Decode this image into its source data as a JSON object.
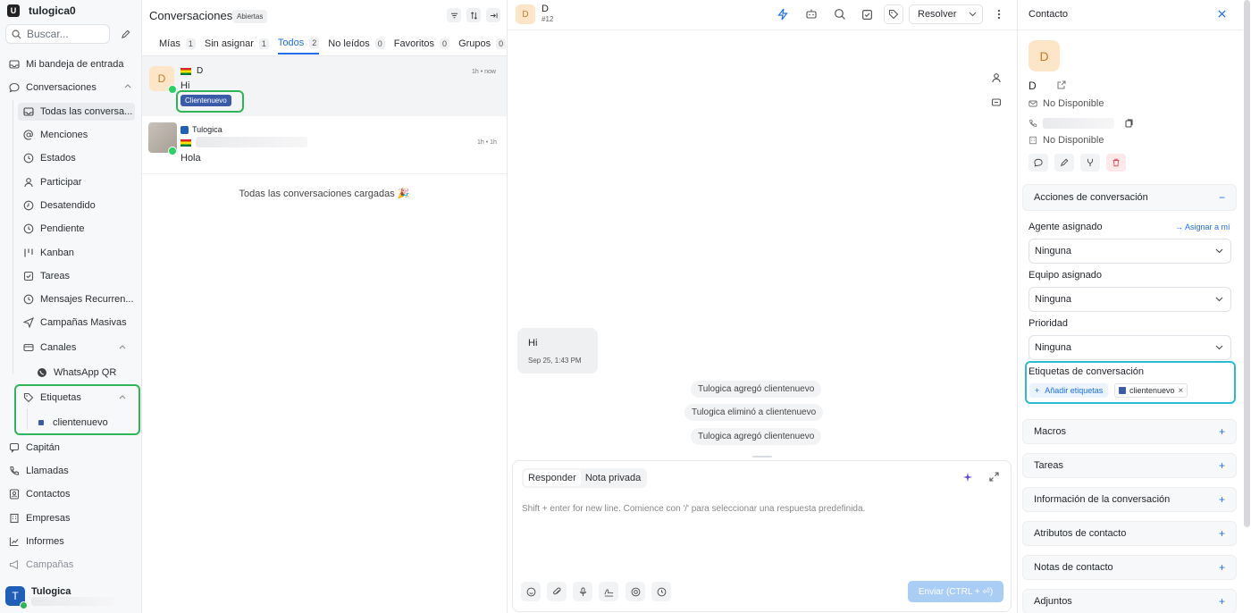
{
  "sidebar": {
    "brand_initial": "U",
    "brand_name": "tulogica0",
    "search_placeholder": "Buscar...",
    "items": {
      "inbox": "Mi bandeja de entrada",
      "conversations": "Conversaciones",
      "all_conversations": "Todas las conversa...",
      "mentions": "Menciones",
      "states": "Estados",
      "participate": "Participar",
      "unattended": "Desatendido",
      "pending": "Pendiente",
      "kanban": "Kanban",
      "tasks": "Tareas",
      "recurring": "Mensajes Recurren...",
      "campaigns_mass": "Campañas Masivas",
      "channels": "Canales",
      "whatsapp_qr": "WhatsApp QR",
      "labels": "Etiquetas",
      "label_clientenuevo": "clientenuevo",
      "captain": "Capitán",
      "calls": "Llamadas",
      "contacts": "Contactos",
      "companies": "Empresas",
      "reports": "Informes",
      "campaigns": "Campañas"
    },
    "user": {
      "initial": "T",
      "name": "Tulogica"
    }
  },
  "conversations": {
    "title": "Conversaciones",
    "status_badge": "Abiertas",
    "tabs": [
      {
        "label": "Mías",
        "count": "1"
      },
      {
        "label": "Sin asignar",
        "count": "1"
      },
      {
        "label": "Todos",
        "count": "2"
      },
      {
        "label": "No leídos",
        "count": "0"
      },
      {
        "label": "Favoritos",
        "count": "0"
      },
      {
        "label": "Grupos",
        "count": "0"
      }
    ],
    "items": [
      {
        "initial": "D",
        "name": "D",
        "time": "1h • now",
        "message": "Hi",
        "label": "Clientenuevo"
      },
      {
        "inbox": "Tulogica",
        "time": "1h • 1h",
        "message": "Hola"
      }
    ],
    "all_loaded": "Todas las conversaciones cargadas 🎉"
  },
  "chat": {
    "contact_initial": "D",
    "contact_name": "D",
    "conversation_id": "#12",
    "resolve_label": "Resolver",
    "message": {
      "text": "Hi",
      "time": "Sep 25, 1:43 PM"
    },
    "activities": [
      "Tulogica agregó clientenuevo",
      "Tulogica eliminó a clientenuevo",
      "Tulogica agregó clientenuevo"
    ],
    "composer": {
      "tab_reply": "Responder",
      "tab_private": "Nota privada",
      "placeholder": "Shift + enter for new line. Comience con '/' para seleccionar una respuesta predefinida.",
      "send_label": "Enviar (CTRL + ⏎)"
    }
  },
  "contact": {
    "title": "Contacto",
    "initial": "D",
    "name": "D",
    "email": "No Disponible",
    "location": "No Disponible",
    "sections": {
      "conversation_actions": "Acciones de conversación",
      "macros": "Macros",
      "tasks": "Tareas",
      "conversation_info": "Información de la conversación",
      "contact_attributes": "Atributos de contacto",
      "contact_notes": "Notas de contacto",
      "attachments": "Adjuntos"
    },
    "assigned_agent_label": "Agente asignado",
    "assign_me": "Asignar a mí",
    "assigned_agent_value": "Ninguna",
    "assigned_team_label": "Equipo asignado",
    "assigned_team_value": "Ninguna",
    "priority_label": "Prioridad",
    "priority_value": "Ninguna",
    "labels_title": "Etiquetas de conversación",
    "add_labels": "Añadir etiquetas",
    "label_chip": "clientenuevo"
  },
  "colors": {
    "accent": "#1f6feb",
    "label": "#3a5ba8",
    "highlight_green": "#2fb457",
    "highlight_cyan": "#2bb9d6"
  }
}
